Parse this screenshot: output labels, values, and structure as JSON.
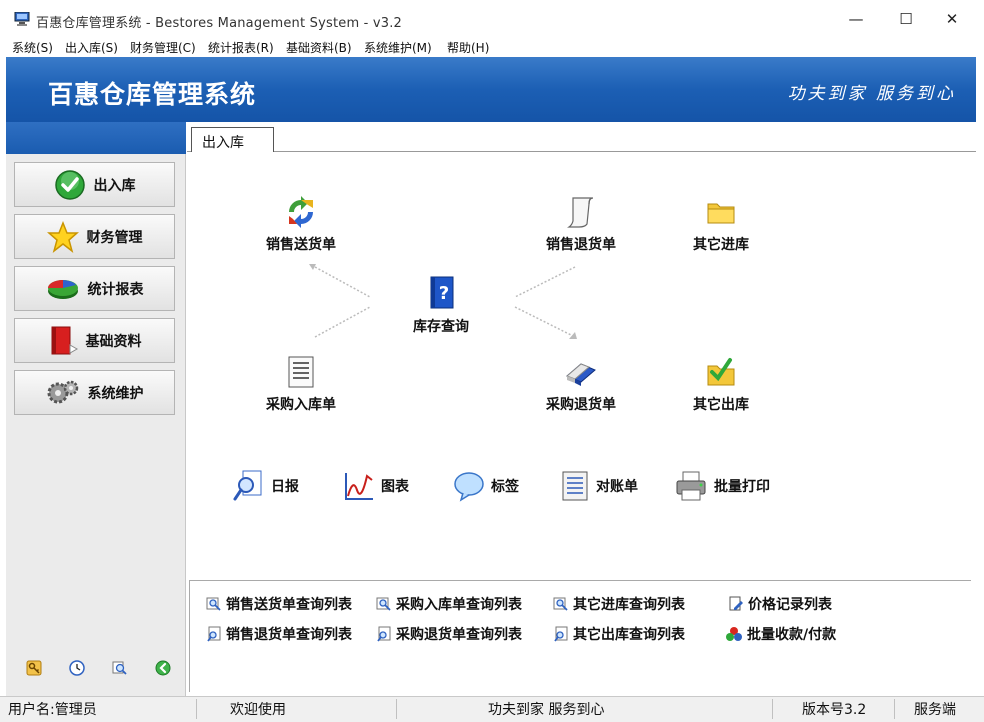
{
  "window": {
    "title": "百惠仓库管理系统 - Bestores Management System - v3.2",
    "minimize_glyph": "—",
    "maximize_glyph": "☐",
    "close_glyph": "✕"
  },
  "menu": [
    {
      "label": "系统(S)"
    },
    {
      "label": "出入库(S)"
    },
    {
      "label": "财务管理(C)"
    },
    {
      "label": "统计报表(R)"
    },
    {
      "label": "基础资料(B)"
    },
    {
      "label": "系统维护(M)"
    },
    {
      "label": "帮助(H)"
    }
  ],
  "banner": {
    "title": "百惠仓库管理系统",
    "slogan": "功夫到家 服务到心"
  },
  "sidebar": {
    "buttons": [
      {
        "label": "出入库",
        "icon": "check-icon"
      },
      {
        "label": "财务管理",
        "icon": "star-icon"
      },
      {
        "label": "统计报表",
        "icon": "pie-chart-icon"
      },
      {
        "label": "基础资料",
        "icon": "book-icon"
      },
      {
        "label": "系统维护",
        "icon": "gear-icon"
      }
    ],
    "tools": [
      "key-icon",
      "clock-icon",
      "search-icon",
      "back-arrow-icon"
    ]
  },
  "main": {
    "tab": "出入库",
    "flow": {
      "sales_delivery": "销售送货单",
      "sales_return": "销售退货单",
      "other_in": "其它进库",
      "stock_query": "库存查询",
      "purchase_in": "采购入库单",
      "purchase_return": "采购退货单",
      "other_out": "其它出库"
    },
    "tools": {
      "daily": "日报",
      "chart": "图表",
      "label": "标签",
      "statement": "对账单",
      "batch_print": "批量打印"
    },
    "links": {
      "sales_delivery_list": "销售送货单查询列表",
      "purchase_in_list": "采购入库单查询列表",
      "other_in_list": "其它进库查询列表",
      "price_record_list": "价格记录列表",
      "sales_return_list": "销售退货单查询列表",
      "purchase_return_list": "采购退货单查询列表",
      "other_out_list": "其它出库查询列表",
      "batch_payment": "批量收款/付款"
    }
  },
  "status": {
    "user": "用户名:管理员",
    "welcome": "欢迎使用",
    "slogan": "功夫到家 服务到心",
    "version": "版本号3.2",
    "mode": "服务端"
  }
}
